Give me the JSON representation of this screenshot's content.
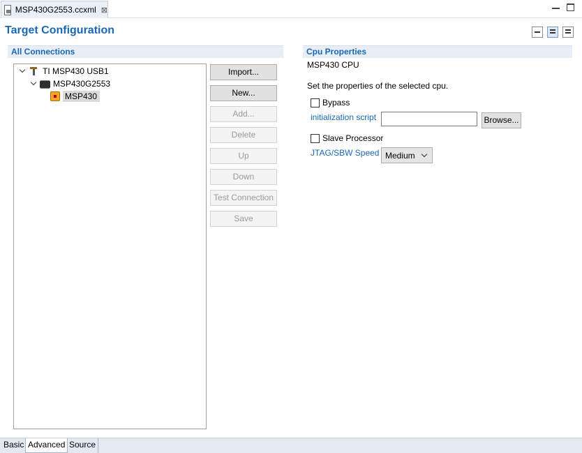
{
  "editor_tab": {
    "title": "MSP430G2553.ccxml",
    "close_glyph": "⊠"
  },
  "page_title": "Target Configuration",
  "left_section": {
    "title": "All Connections"
  },
  "tree": {
    "connection": "TI MSP430 USB1",
    "device": "MSP430G2553",
    "cpu": "MSP430"
  },
  "buttons": {
    "import": "Import...",
    "new": "New...",
    "add": "Add...",
    "delete": "Delete",
    "up": "Up",
    "down": "Down",
    "test_connection": "Test Connection",
    "save": "Save"
  },
  "right_section": {
    "title": "Cpu Properties",
    "cpu_name": "MSP430 CPU",
    "description": "Set the properties of the selected cpu.",
    "bypass_label": "Bypass",
    "bypass_checked": false,
    "init_script_label": "initialization script",
    "init_script_value": "",
    "browse_label": "Browse...",
    "slave_label": "Slave Processor",
    "slave_checked": false,
    "jtag_label": "JTAG/SBW Speed",
    "jtag_value": "Medium"
  },
  "bottom_tabs": [
    "Basic",
    "Advanced",
    "Source"
  ],
  "active_bottom_tab": "Advanced",
  "colors": {
    "accent": "#1a67b5",
    "section_bg": "#e7eef6"
  }
}
